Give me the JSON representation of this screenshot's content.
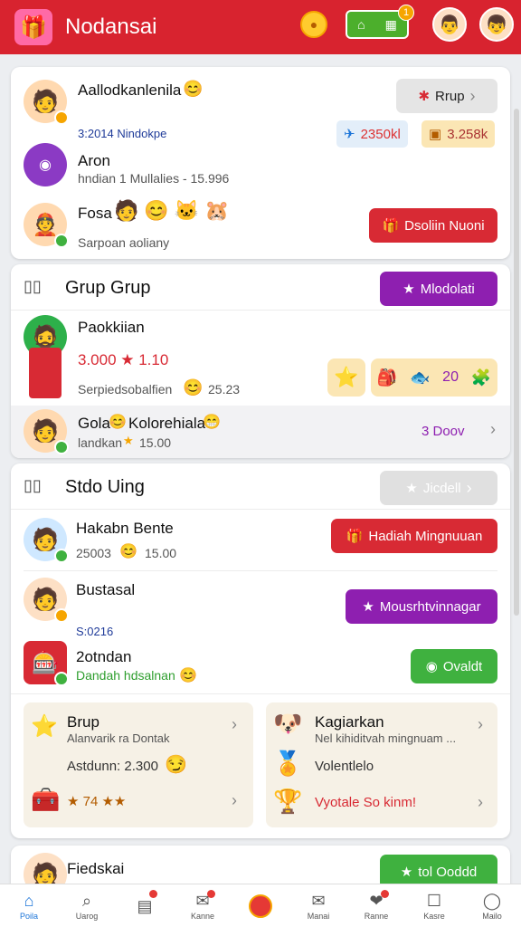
{
  "app": {
    "title": "Nodansai"
  },
  "header": {
    "coin_glyph": "●",
    "pill_badge": "1"
  },
  "card1": {
    "user1": {
      "name": "Aallodkanlenila",
      "stats": "3:2014  Nindokpe"
    },
    "user2": {
      "name": "Aron",
      "sub": "hndian 1 Mullalies - 15.996"
    },
    "user3": {
      "name": "Fosa",
      "sub": "Sarpoan aoliany"
    },
    "grup_button": "Rrup",
    "chip1": "2350kl",
    "chip2": "3.258k",
    "red_button": "Dsoliin Nuoni"
  },
  "card2": {
    "title": "Grup Grup",
    "purple_button": "Mlodolati",
    "user1": {
      "name": "Paokkiian",
      "score": "3.000 ★ 1.10",
      "sub": "Serpiedsobalfien",
      "sub_value": "25.23"
    },
    "reward_count": "20",
    "row2": {
      "name": "Gola",
      "name2": "Kolorehiala",
      "sub": "landkan",
      "sub_value": "15.00",
      "right": "3 Doov"
    }
  },
  "card3": {
    "title": "Stdo Uing",
    "ghost_button": "Jicdell",
    "user1": {
      "name": "Hakabn Bente",
      "sub": "25003",
      "sub_value": "15.00",
      "button": "Hadiah Mingnuuan"
    },
    "user2": {
      "name": "Bustasal",
      "sub": "S:0216",
      "button": "Mousrhtvinnagar"
    },
    "user3": {
      "name": "2otndan",
      "sub": "Dandah hdsalnan",
      "button": "Ovaldt"
    },
    "panel_left": {
      "title": "Brup",
      "line1": "Alanvarik ra Dontak",
      "line2_label": "Astdunn: 2.300",
      "row3": "★ 74 ★★"
    },
    "panel_right": {
      "title": "Kagiarkan",
      "line1": "Nel kihiditvah mingnuam ...",
      "line2": "Volentlelo",
      "line3": "Vyotale So kinm!"
    }
  },
  "card4": {
    "name": "Fiedskai",
    "button": "tol Ooddd"
  },
  "nav": [
    {
      "label": "Poila",
      "icon": "home-icon",
      "glyph": "⌂"
    },
    {
      "label": "Uarog",
      "icon": "search-icon",
      "glyph": "⌕"
    },
    {
      "label": "",
      "icon": "document-icon",
      "glyph": "▤"
    },
    {
      "label": "Kanne",
      "icon": "chat-icon",
      "glyph": "✉"
    },
    {
      "label": "",
      "icon": "center-action-icon",
      "glyph": ""
    },
    {
      "label": "Manai",
      "icon": "mail-icon",
      "glyph": "✉"
    },
    {
      "label": "Ranne",
      "icon": "gift-icon",
      "glyph": "❤"
    },
    {
      "label": "Kasre",
      "icon": "chat-bubble-icon",
      "glyph": "☐"
    },
    {
      "label": "Mailo",
      "icon": "profile-icon",
      "glyph": "◯"
    }
  ],
  "colors": {
    "brand": "#d8232f",
    "purple": "#8e1fb0",
    "green": "#3fb13f",
    "link": "#1b74d8"
  }
}
